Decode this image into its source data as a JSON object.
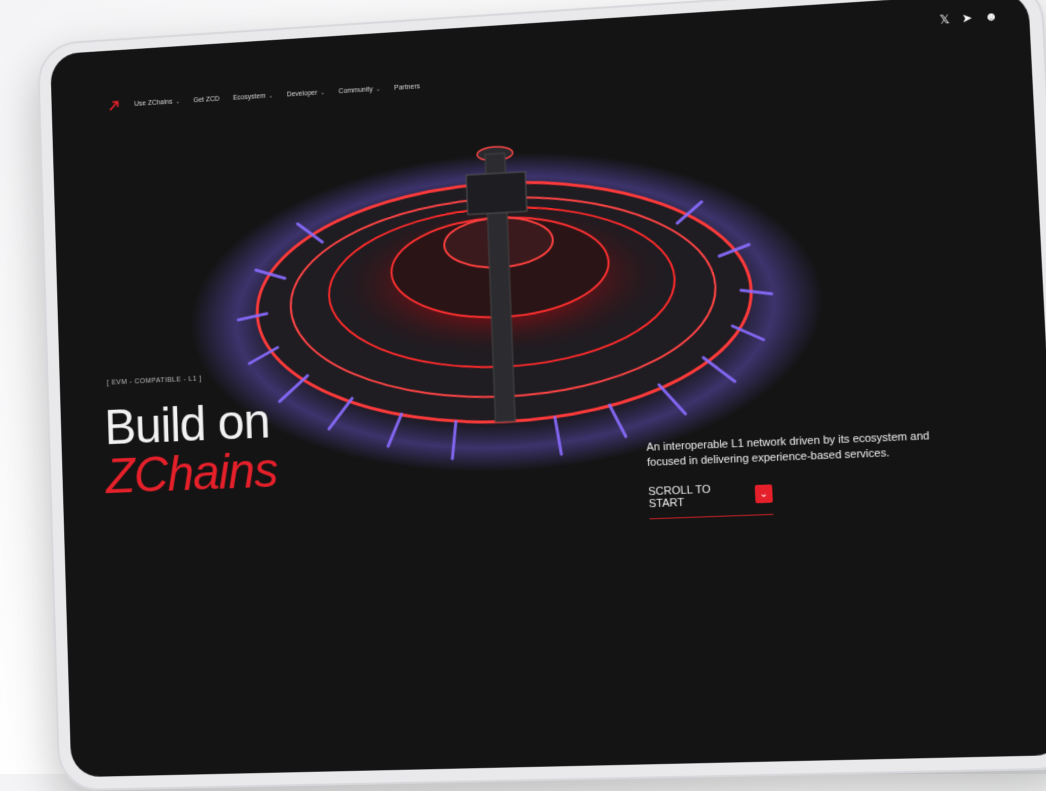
{
  "nav": {
    "items": [
      {
        "label": "Use ZChains",
        "has_chevron": true
      },
      {
        "label": "Get ZCD",
        "has_chevron": false
      },
      {
        "label": "Ecosystem",
        "has_chevron": true
      },
      {
        "label": "Developer",
        "has_chevron": true
      },
      {
        "label": "Community",
        "has_chevron": true
      },
      {
        "label": "Partners",
        "has_chevron": false
      }
    ]
  },
  "socials": {
    "x": "𝕏",
    "telegram": "➤",
    "discord": "☻"
  },
  "hero": {
    "tag": "[ EVM - COMPATIBLE - L1 ]",
    "title_line1": "Build on",
    "title_line2": "ZChains",
    "description": "An interoperable L1 network driven by its ecosystem and focused in delivering experience-based services.",
    "scroll_label": "SCROLL TO START",
    "scroll_icon": "chevron-down-icon"
  },
  "colors": {
    "accent": "#e5202a",
    "screen_bg": "#141414",
    "neon_purple": "#8a6cff"
  }
}
